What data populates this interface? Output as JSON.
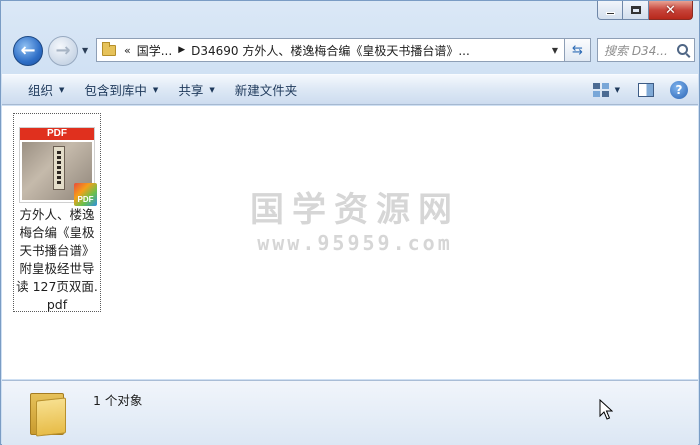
{
  "titlebar": {
    "minimize_symbol": "",
    "maximize_symbol": "",
    "close_symbol": "✕"
  },
  "nav": {
    "back_arrow": "←",
    "forward_arrow": "→",
    "address": {
      "chevrons": "«",
      "crumb_root": "国学...",
      "crumb_sep": "▶",
      "crumb_current": "D34690 方外人、楼逸梅合编《皇极天书播台谱》..."
    },
    "search_placeholder": "搜索 D34..."
  },
  "toolbar": {
    "organize_label": "组织",
    "include_library_label": "包含到库中",
    "share_label": "共享",
    "new_folder_label": "新建文件夹"
  },
  "content": {
    "file": {
      "thumb_band": "PDF",
      "badge": "PDF",
      "name": "方外人、楼逸梅合编《皇极天书播台谱》附皇极经世导读 127页双面.pdf"
    },
    "watermark": {
      "title": "国学资源网",
      "url": "www.95959.com"
    }
  },
  "details": {
    "item_count": "1 个对象"
  },
  "colors": {
    "accent": "#2f6fc7",
    "pdf_red": "#e0301e",
    "toolbar_text": "#1e395b"
  }
}
